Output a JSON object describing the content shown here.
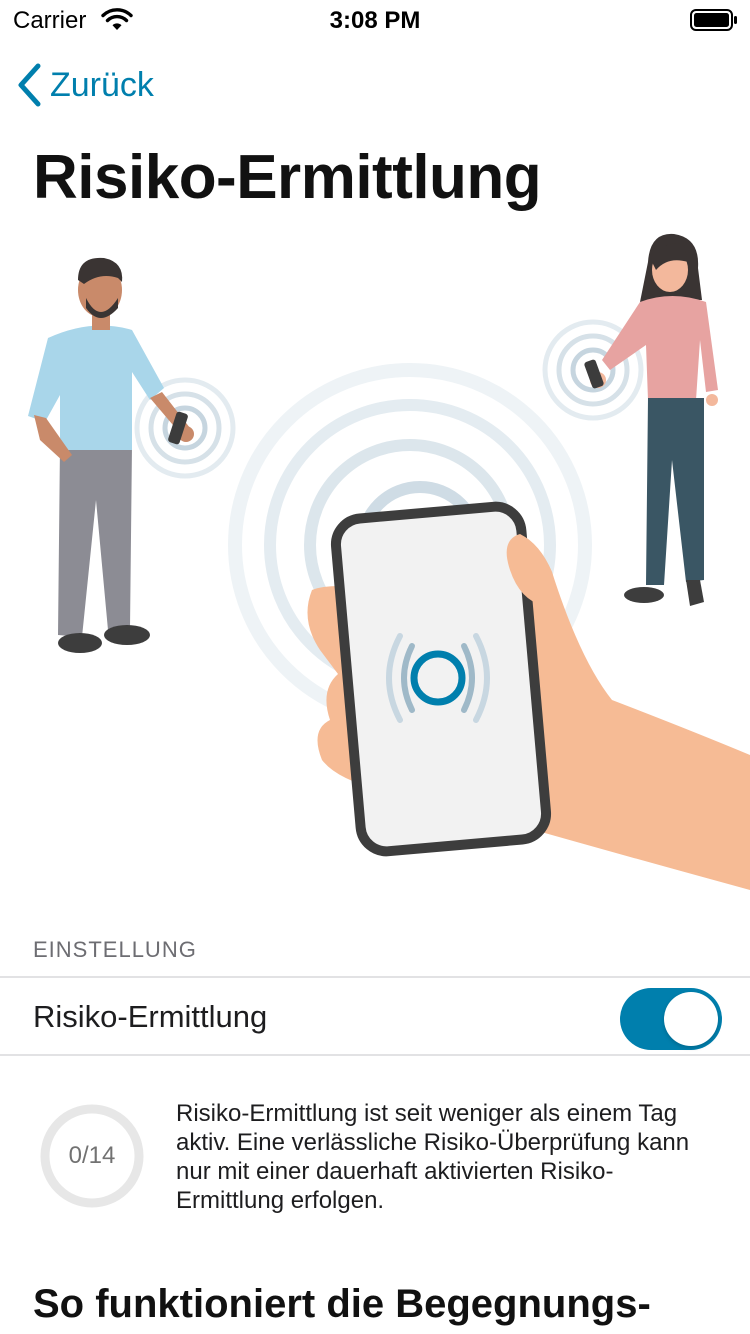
{
  "status_bar": {
    "carrier": "Carrier",
    "time": "3:08 PM"
  },
  "nav": {
    "back_label": "Zurück"
  },
  "page": {
    "title": "Risiko-Ermittlung"
  },
  "settings": {
    "section_header": "EINSTELLUNG",
    "toggle_label": "Risiko-Ermittlung",
    "toggle_on": true
  },
  "progress": {
    "label": "0/14",
    "fraction": 0
  },
  "info": {
    "text": "Risiko-Ermittlung ist seit weniger als einem Tag aktiv. Eine verlässliche Risiko-Überprüfung kann nur mit einer dauerhaft aktivierten Risiko-Ermittlung erfolgen."
  },
  "how_it_works": {
    "title": "So funktioniert die Begegnungs-"
  },
  "colors": {
    "accent": "#007fad",
    "section_gray": "#6d6d72",
    "divider": "#e2e2e4"
  },
  "icons": {
    "back": "chevron-left-icon",
    "wifi": "wifi-icon",
    "battery": "battery-icon"
  }
}
